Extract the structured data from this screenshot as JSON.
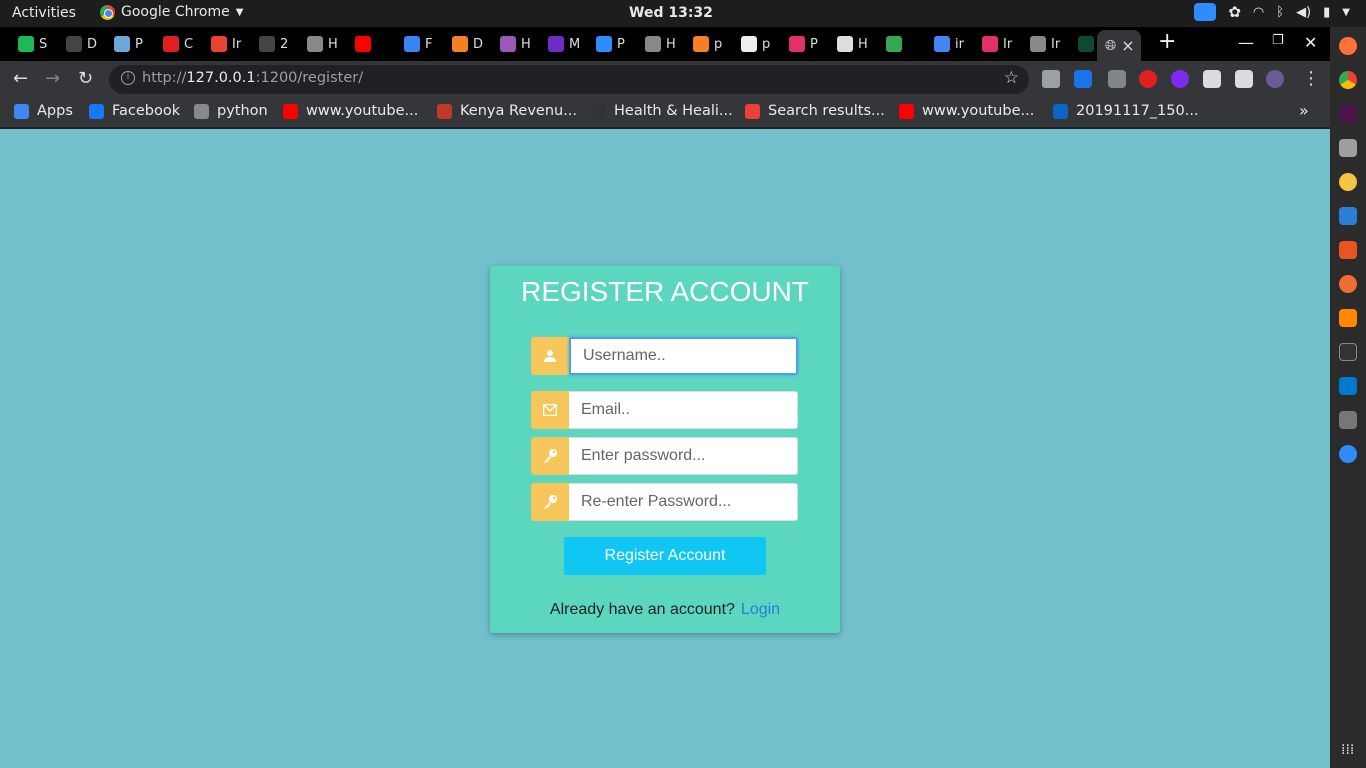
{
  "topbar": {
    "activities": "Activities",
    "app_name": "Google Chrome",
    "clock": "Wed 13:32"
  },
  "tabs": [
    {
      "label": "S",
      "color": "#1db954"
    },
    {
      "label": "D",
      "color": "#444"
    },
    {
      "label": "P",
      "color": "#6ea8d8"
    },
    {
      "label": "C",
      "color": "#e02020"
    },
    {
      "label": "Ir",
      "color": "#ea4335"
    },
    {
      "label": "2",
      "color": "#444"
    },
    {
      "label": "H",
      "color": "#888"
    },
    {
      "label": "",
      "color": "#ff0000"
    },
    {
      "label": "F",
      "color": "#3b82f6"
    },
    {
      "label": "D",
      "color": "#f48024"
    },
    {
      "label": "H",
      "color": "#9b59b6"
    },
    {
      "label": "M",
      "color": "#6c2dc7"
    },
    {
      "label": "P",
      "color": "#2d8cff"
    },
    {
      "label": "H",
      "color": "#888"
    },
    {
      "label": "p",
      "color": "#f48024"
    },
    {
      "label": "p",
      "color": "#eee"
    },
    {
      "label": "P",
      "color": "#e1306c"
    },
    {
      "label": "H",
      "color": "#ddd"
    },
    {
      "label": "",
      "color": "#34a853"
    },
    {
      "label": "ir",
      "color": "#4285f4"
    },
    {
      "label": "Ir",
      "color": "#e1306c"
    },
    {
      "label": "Ir",
      "color": "#888"
    },
    {
      "label": "T",
      "color": "#0c4b33"
    }
  ],
  "active_tab": {
    "close": "×"
  },
  "new_tab": "+",
  "window_controls": {
    "minimize": "—",
    "maximize": "❐",
    "close": "✕"
  },
  "toolbar": {
    "url_host": "http://",
    "url_main": "127.0.0.1",
    "url_rest": ":1200/register/"
  },
  "bookmarks": [
    {
      "label": "Apps",
      "color": "#4285f4"
    },
    {
      "label": "Facebook",
      "color": "#1877f2"
    },
    {
      "label": "python",
      "color": "#888"
    },
    {
      "label": "www.youtube...",
      "color": "#ff0000"
    },
    {
      "label": "Kenya Revenu...",
      "color": "#c0392b"
    },
    {
      "label": "Health & Heali...",
      "color": "#333"
    },
    {
      "label": "Search results...",
      "color": "#ea4335"
    },
    {
      "label": "www.youtube...",
      "color": "#ff0000"
    },
    {
      "label": "20191117_150...",
      "color": "#0a66c2"
    }
  ],
  "bookmarks_more": "»",
  "form": {
    "title": "REGISTER ACCOUNT",
    "username_placeholder": "Username..",
    "email_placeholder": "Email..",
    "password_placeholder": "Enter password...",
    "password2_placeholder": "Re-enter Password...",
    "submit": "Register Account",
    "login_prompt": "Already have an account?",
    "login_link": "Login"
  },
  "colors": {
    "page_bg": "#71c0cb",
    "card_bg": "#5bd6bf",
    "icon_bg": "#f7c65a",
    "button_bg": "#10c7f4",
    "link": "#2b7bd6"
  }
}
